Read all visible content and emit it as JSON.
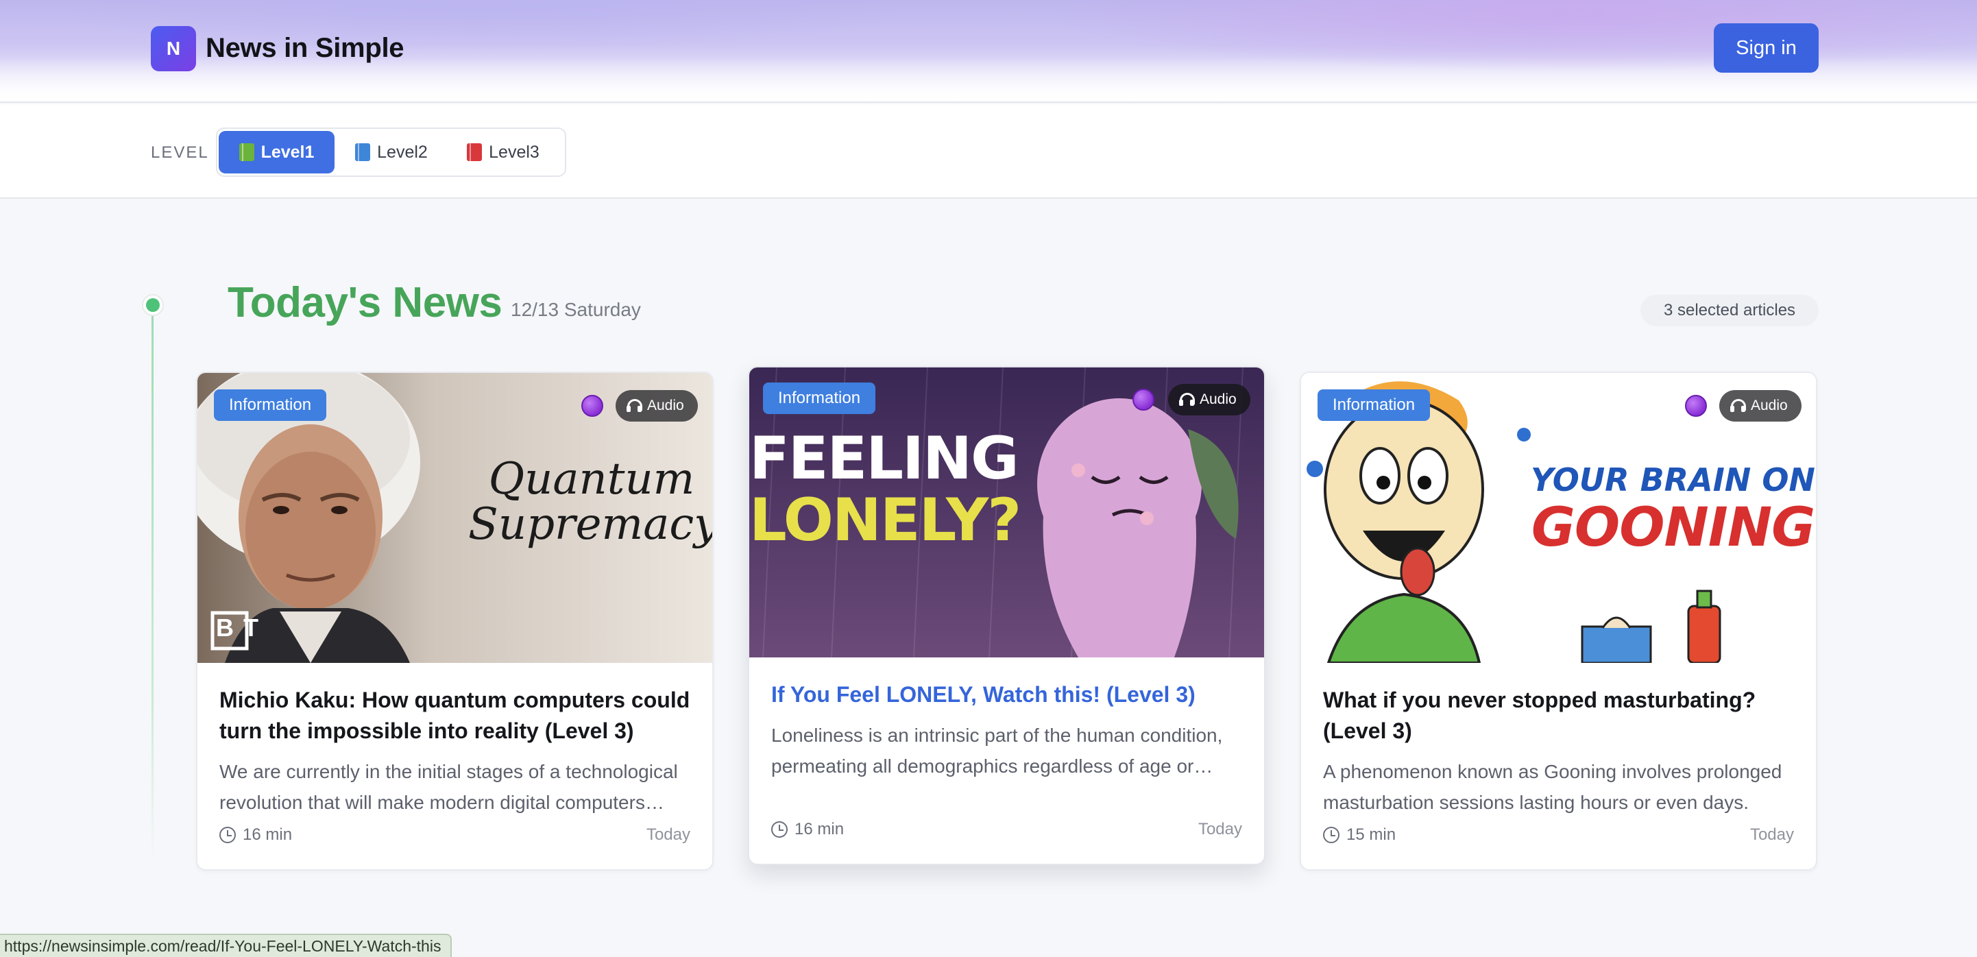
{
  "header": {
    "logo_letter": "N",
    "brand": "News in Simple",
    "signin_label": "Sign in"
  },
  "level_bar": {
    "label": "LEVEL",
    "levels": [
      {
        "label": "Level1",
        "icon": "green-book-icon",
        "active": true
      },
      {
        "label": "Level2",
        "icon": "blue-book-icon",
        "active": false
      },
      {
        "label": "Level3",
        "icon": "red-book-icon",
        "active": false
      }
    ]
  },
  "section": {
    "title": "Today's News",
    "date": "12/13 Saturday",
    "selected_count": "3 selected articles"
  },
  "cards": [
    {
      "category": "Information",
      "audio_label": "Audio",
      "thumb_text": [
        "Quantum",
        "Supremacy"
      ],
      "thumb_logo": "BT",
      "title": "Michio Kaku: How quantum computers could turn the impossible into reality (Level 3)",
      "description": "We are currently in the initial stages of a technological revolution that will make modern digital computers obsolete.",
      "duration": "16 min",
      "date": "Today"
    },
    {
      "category": "Information",
      "audio_label": "Audio",
      "thumb_text": [
        "FEELING",
        "LONELY?"
      ],
      "title": "If You Feel LONELY, Watch this! (Level 3)",
      "description": "Loneliness is an intrinsic part of the human condition, permeating all demographics regardless of age or background.",
      "duration": "16 min",
      "date": "Today"
    },
    {
      "category": "Information",
      "audio_label": "Audio",
      "thumb_text": [
        "YOUR BRAIN ON",
        "GOONING"
      ],
      "title": "What if you never stopped masturbating? (Level 3)",
      "description": "A phenomenon known as Gooning involves prolonged masturbation sessions lasting hours or even days.",
      "duration": "15 min",
      "date": "Today"
    }
  ],
  "status_bar": {
    "url": "https://newsinsimple.com/read/If-You-Feel-LONELY-Watch-this"
  },
  "colors": {
    "accent": "#3f6fe2",
    "section_title": "#47a55a",
    "info_badge": "#3f7fe0"
  }
}
